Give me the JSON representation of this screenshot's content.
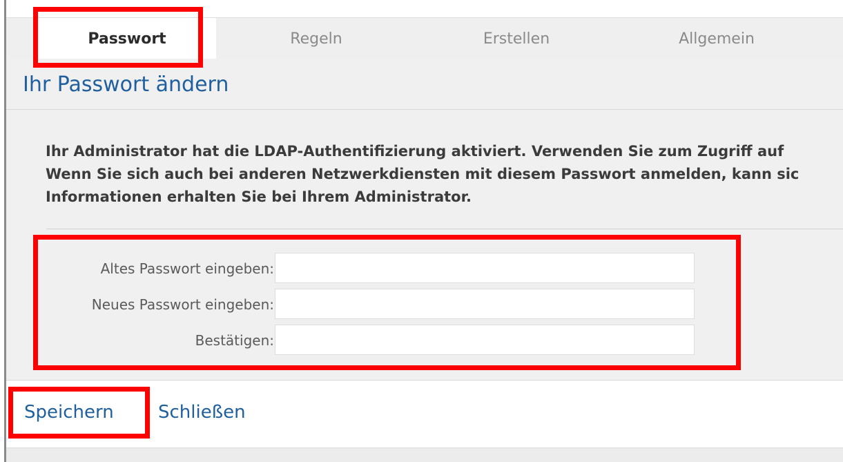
{
  "tabs": [
    {
      "label": "Passwort",
      "active": true
    },
    {
      "label": "Regeln",
      "active": false
    },
    {
      "label": "Erstellen",
      "active": false
    },
    {
      "label": "Allgemein",
      "active": false
    }
  ],
  "panel": {
    "title": "Ihr Passwort ändern",
    "notice_lines": [
      "Ihr Administrator hat die LDAP-Authentifizierung aktiviert. Verwenden Sie zum Zugriff auf",
      "Wenn Sie sich auch bei anderen Netzwerkdiensten mit diesem Passwort anmelden, kann sic",
      "Informationen erhalten Sie bei Ihrem Administrator."
    ],
    "fields": {
      "old_password": {
        "label": "Altes Passwort eingeben:",
        "value": ""
      },
      "new_password": {
        "label": "Neues Passwort eingeben:",
        "value": ""
      },
      "confirm": {
        "label": "Bestätigen:",
        "value": ""
      }
    }
  },
  "actions": {
    "save": "Speichern",
    "close": "Schließen"
  },
  "colors": {
    "accent_blue": "#1f5f9e",
    "highlight_red": "#ff0000",
    "panel_bg": "#f0f0f0",
    "tab_strip_bg": "#efefef"
  }
}
